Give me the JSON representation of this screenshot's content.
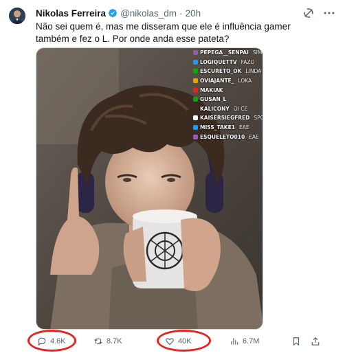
{
  "tweet": {
    "author_name": "Nikolas Ferreira",
    "handle": "@nikolas_dm",
    "separator": "·",
    "time": "20h",
    "text": "Não sei quem é, mas me disseram que ele é influência gamer também e fez o L. Por onde anda esse pateta?"
  },
  "icons": {
    "verified": "verified-badge-icon",
    "grok": "grok-icon",
    "more": "more-options-icon",
    "reply": "reply-bubble-icon",
    "retweet": "retweet-icon",
    "like": "heart-icon",
    "views": "views-bar-chart-icon",
    "bookmark": "bookmark-icon",
    "share": "share-icon"
  },
  "media": {
    "chat": [
      {
        "user": "PEPEGA__SENPAI",
        "msg": "SIM"
      },
      {
        "user": "LOGIQUETTV",
        "msg": "FAZO"
      },
      {
        "user": "ESCURETO_OK",
        "msg": "LINDA"
      },
      {
        "user": "OVIAJANTE_",
        "msg": "LOKA"
      },
      {
        "user": "MAKIAK",
        "msg": ""
      },
      {
        "user": "GUSAN_L",
        "msg": ""
      },
      {
        "user": "KALICONY",
        "msg": "OI CE"
      },
      {
        "user": "KAISERSIEGFRED",
        "msg": "SPOIL"
      },
      {
        "user": "MISS_TAKE1",
        "msg": "EAE"
      },
      {
        "user": "ESQUELETO010",
        "msg": "EAE"
      }
    ]
  },
  "actions": {
    "replies": "4.6K",
    "retweets": "8.7K",
    "likes": "40K",
    "views": "6.7M"
  },
  "colors": {
    "verified": "#1d9bf0",
    "muted": "#536471",
    "annotation": "#e8221e"
  }
}
